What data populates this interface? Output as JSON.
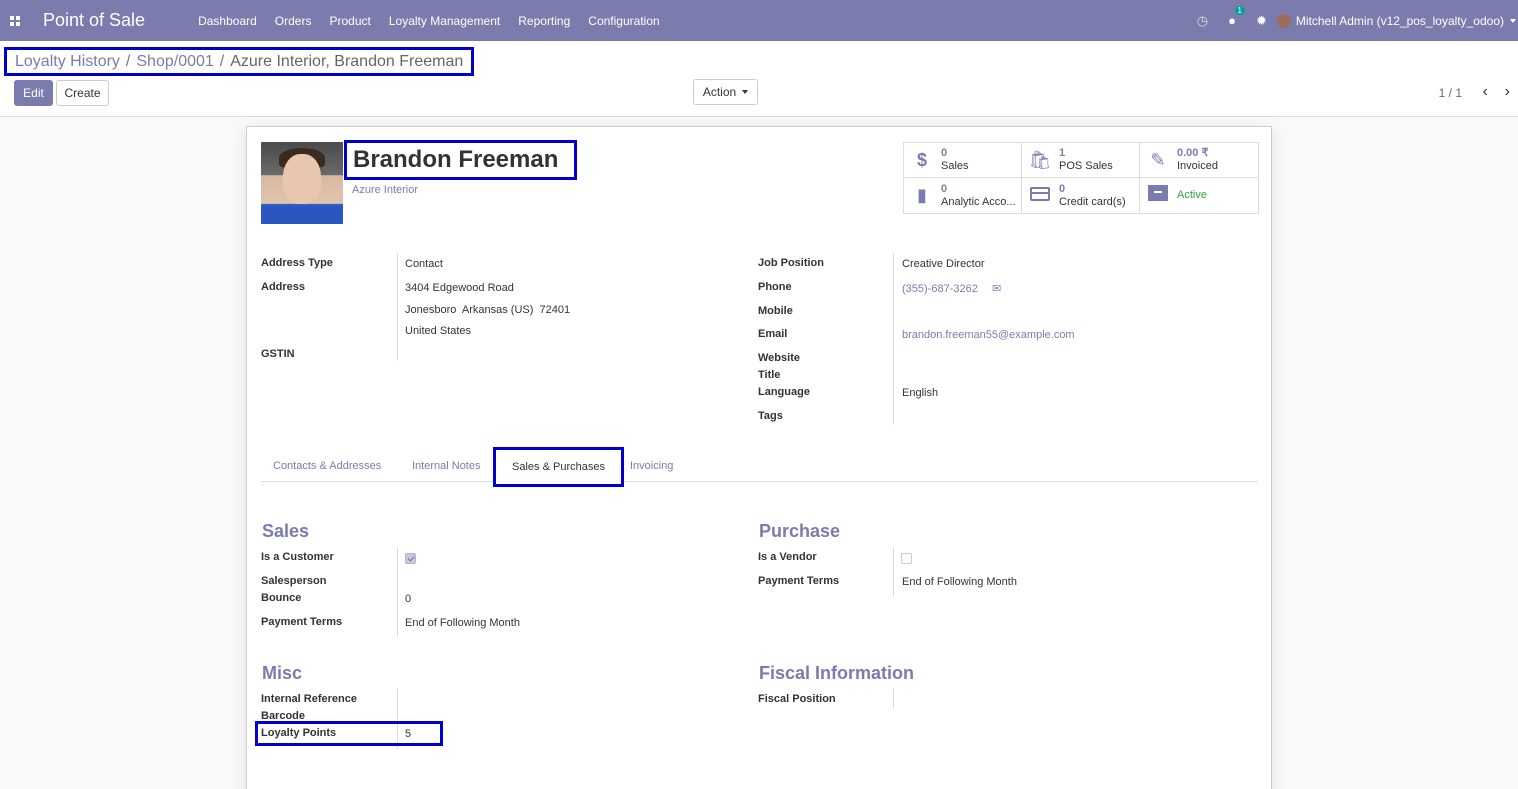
{
  "navbar": {
    "app_title": "Point of Sale",
    "menu": [
      "Dashboard",
      "Orders",
      "Product",
      "Loyalty Management",
      "Reporting",
      "Configuration"
    ],
    "chat_badge": "1",
    "user": "Mitchell Admin (v12_pos_loyalty_odoo)",
    "color": "#7c7bad"
  },
  "breadcrumb": {
    "items": [
      "Loyalty History",
      "Shop/0001"
    ],
    "current": "Azure Interior, Brandon Freeman"
  },
  "toolbar": {
    "edit": "Edit",
    "create": "Create",
    "action": "Action",
    "pager": "1 / 1"
  },
  "partner": {
    "name": "Brandon Freeman",
    "company": "Azure Interior"
  },
  "stats": [
    {
      "icon": "dollar-icon",
      "value": "0",
      "label": "Sales"
    },
    {
      "icon": "shopping-bag-icon",
      "value": "1",
      "label": "POS Sales"
    },
    {
      "icon": "edit-invoice-icon",
      "value": "0.00 ₹",
      "label": "Invoiced"
    },
    {
      "icon": "book-icon",
      "value": "0",
      "label": "Analytic Acco..."
    },
    {
      "icon": "credit-card-icon",
      "value": "0",
      "label": "Credit card(s)"
    },
    {
      "icon": "archive-icon",
      "value": "",
      "label": "Active"
    }
  ],
  "left_fields": {
    "address_type_label": "Address Type",
    "address_type": "Contact",
    "address_label": "Address",
    "street": "3404 Edgewood Road",
    "city_line": "Jonesboro  Arkansas (US)  72401",
    "country": "United States",
    "gstin_label": "GSTIN"
  },
  "right_fields": {
    "job_label": "Job Position",
    "job": "Creative Director",
    "phone_label": "Phone",
    "phone": "(355)-687-3262",
    "mobile_label": "Mobile",
    "email_label": "Email",
    "email": "brandon.freeman55@example.com",
    "website_label": "Website",
    "title_label": "Title",
    "language_label": "Language",
    "language": "English",
    "tags_label": "Tags"
  },
  "tabs": [
    "Contacts & Addresses",
    "Internal Notes",
    "Sales & Purchases",
    "Invoicing"
  ],
  "sales": {
    "title": "Sales",
    "is_customer_label": "Is a Customer",
    "is_customer": true,
    "salesperson_label": "Salesperson",
    "bounce_label": "Bounce",
    "bounce": "0",
    "payment_terms_label": "Payment Terms",
    "payment_terms": "End of Following Month"
  },
  "purchase": {
    "title": "Purchase",
    "is_vendor_label": "Is a Vendor",
    "is_vendor": false,
    "payment_terms_label": "Payment Terms",
    "payment_terms": "End of Following Month"
  },
  "misc": {
    "title": "Misc",
    "internal_ref_label": "Internal Reference",
    "barcode_label": "Barcode",
    "loyalty_label": "Loyalty Points",
    "loyalty": "5"
  },
  "fiscal": {
    "title": "Fiscal Information",
    "fiscal_position_label": "Fiscal Position"
  }
}
